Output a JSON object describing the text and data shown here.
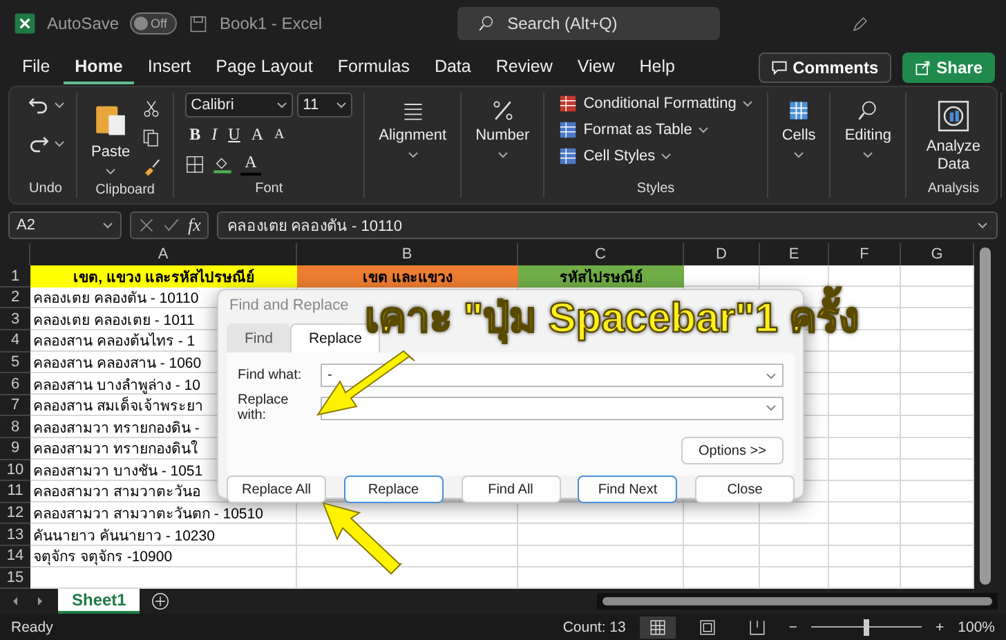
{
  "title_bar": {
    "autosave": {
      "label": "AutoSave",
      "on": false,
      "state_label": "Off"
    },
    "document": "Book1  -  Excel",
    "search": "Search (Alt+Q)"
  },
  "menu": {
    "tabs": [
      {
        "label": "File",
        "selected": false
      },
      {
        "label": "Home",
        "selected": true
      },
      {
        "label": "Insert",
        "selected": false
      },
      {
        "label": "Page Layout",
        "selected": false
      },
      {
        "label": "Formulas",
        "selected": false
      },
      {
        "label": "Data",
        "selected": false
      },
      {
        "label": "Review",
        "selected": false
      },
      {
        "label": "View",
        "selected": false
      },
      {
        "label": "Help",
        "selected": false
      }
    ],
    "comments": "Comments",
    "share": "Share"
  },
  "ribbon": {
    "groups": [
      {
        "kind": "undo",
        "label": "Undo"
      },
      {
        "kind": "clipboard",
        "label": "Clipboard",
        "button": "Paste"
      },
      {
        "kind": "font",
        "label": "Font",
        "font": "Calibri",
        "size": "11",
        "buttons": [
          "B",
          "I",
          "U"
        ],
        "grow": "A",
        "shrink": "A",
        "color_button": "A"
      },
      {
        "kind": "alignment",
        "button": "Alignment"
      },
      {
        "kind": "number",
        "button": "Number"
      },
      {
        "kind": "styles",
        "label": "Styles",
        "items": [
          "Conditional Formatting",
          "Format as Table",
          "Cell Styles"
        ]
      },
      {
        "kind": "cells",
        "button": "Cells"
      },
      {
        "kind": "editing",
        "button": "Editing"
      },
      {
        "kind": "analysis",
        "label": "Analysis",
        "button": "Analyze Data"
      }
    ]
  },
  "formula_bar": {
    "name_box": "A2",
    "fx": "fx",
    "content": "คลองเตย คลองตัน - 10110"
  },
  "sheet": {
    "columns": [
      "A",
      "B",
      "C",
      "D",
      "E",
      "F",
      "G"
    ],
    "rows": [
      {
        "number": "1",
        "cells": [
          {
            "text": "เขต, แขวง และรหัสไปรษณีย์",
            "color": "#ffff00"
          },
          {
            "text": "เขต และแขวง",
            "color": "#ed7d31"
          },
          {
            "text": "รหัสไปรษณีย์",
            "color": "#70ad47"
          }
        ]
      },
      {
        "number": "2",
        "cells": [
          {
            "text": "คลองเตย คลองตัน - 10110"
          }
        ]
      },
      {
        "number": "3",
        "cells": [
          {
            "text": "คลองเตย คลองเตย - 1011"
          }
        ]
      },
      {
        "number": "4",
        "cells": [
          {
            "text": "คลองสาน คลองต้นไทร - 1"
          }
        ]
      },
      {
        "number": "5",
        "cells": [
          {
            "text": "คลองสาน คลองสาน - 1060"
          }
        ]
      },
      {
        "number": "6",
        "cells": [
          {
            "text": "คลองสาน บางลำพูล่าง - 10"
          }
        ]
      },
      {
        "number": "7",
        "cells": [
          {
            "text": "คลองสาน สมเด็จเจ้าพระยา"
          }
        ]
      },
      {
        "number": "8",
        "cells": [
          {
            "text": "คลองสามวา ทรายกองดิน -"
          }
        ]
      },
      {
        "number": "9",
        "cells": [
          {
            "text": "คลองสามวา ทรายกองดินใ"
          }
        ]
      },
      {
        "number": "10",
        "cells": [
          {
            "text": "คลองสามวา บางชัน - 1051"
          }
        ]
      },
      {
        "number": "11",
        "cells": [
          {
            "text": "คลองสามวา สามวาตะวันอ"
          }
        ]
      },
      {
        "number": "12",
        "cells": [
          {
            "text": "คลองสามวา สามวาตะวันตก - 10510"
          }
        ]
      },
      {
        "number": "13",
        "cells": [
          {
            "text": "คันนายาว คันนายาว - 10230"
          }
        ]
      },
      {
        "number": "14",
        "cells": [
          {
            "text": "จตุจักร จตุจักร -10900"
          }
        ]
      },
      {
        "number": "15",
        "cells": []
      }
    ]
  },
  "dialog": {
    "title": "Find and Replace",
    "tabs": [
      {
        "label": "Find",
        "selected": false
      },
      {
        "label": "Replace",
        "selected": true
      }
    ],
    "fields": [
      {
        "label": "Find what:",
        "value": "-"
      },
      {
        "label": "Replace with:"
      }
    ],
    "options": "Options >>",
    "buttons": [
      {
        "label": "Replace All",
        "focused": false
      },
      {
        "label": "Replace",
        "focused": true
      },
      {
        "label": "Find All",
        "focused": false
      },
      {
        "label": "Find Next",
        "focused": true
      },
      {
        "label": "Close",
        "focused": false
      }
    ]
  },
  "annotation": {
    "text": "เคาะ \"ปุ่ม Spacebar\"1 ครั้ง"
  },
  "sheet_tabs": [
    {
      "label": "Sheet1",
      "selected": true
    }
  ],
  "status_bar": {
    "ready": "Ready",
    "count": "Count: 13",
    "views": [
      {
        "kind": "normal",
        "selected": true
      },
      {
        "kind": "layout",
        "selected": false
      },
      {
        "kind": "break",
        "selected": false
      }
    ],
    "zoom": {
      "minus": "−",
      "plus": "+",
      "level": 0.5,
      "reading": "100%"
    }
  }
}
